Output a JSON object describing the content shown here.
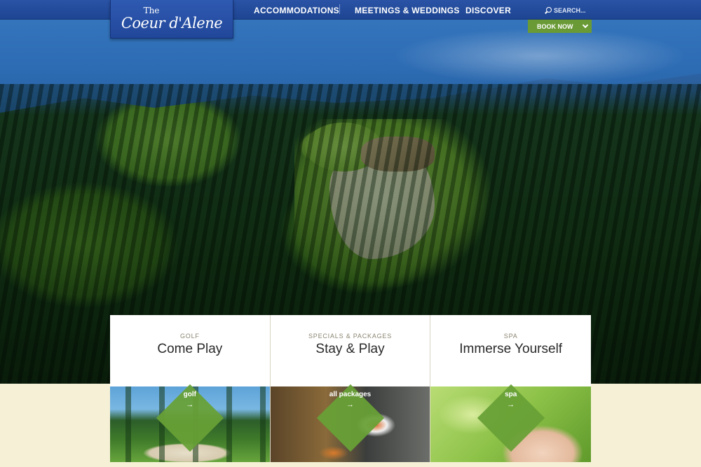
{
  "logo": {
    "the": "The",
    "name": "Coeur d'Alene"
  },
  "nav": {
    "items": [
      {
        "label": "ACCOMMODATIONS"
      },
      {
        "label": "MEETINGS & WEDDINGS"
      },
      {
        "label": "DISCOVER"
      }
    ],
    "search_placeholder": "SEARCH...",
    "book_now": "BOOK NOW"
  },
  "cards": [
    {
      "category": "GOLF",
      "headline": "Come Play",
      "link_label": "golf",
      "arrow": "→"
    },
    {
      "category": "SPECIALS & PACKAGES",
      "headline": "Stay & Play",
      "link_label": "all packages",
      "arrow": "→"
    },
    {
      "category": "SPA",
      "headline": "Immerse Yourself",
      "link_label": "spa",
      "arrow": "→"
    }
  ],
  "colors": {
    "header_blue": "#2a53a6",
    "accent_green": "#6a9a36",
    "page_cream": "#f6f1d6"
  }
}
